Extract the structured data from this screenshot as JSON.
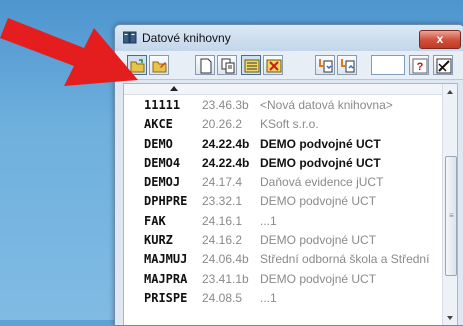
{
  "window": {
    "title": "Datové knihovny",
    "close_label": "x"
  },
  "toolbar": {
    "buttons": [
      {
        "name": "open-folder-button",
        "icon": "open-folder-icon"
      },
      {
        "name": "edit-folder-button",
        "icon": "folder-edit-icon"
      },
      {
        "name": "new-document-button",
        "icon": "document-icon"
      },
      {
        "name": "copy-document-button",
        "icon": "copy-icon"
      },
      {
        "name": "view-list-button",
        "icon": "list-view-icon"
      },
      {
        "name": "delete-button",
        "icon": "delete-icon"
      },
      {
        "name": "import-button",
        "icon": "import-icon"
      },
      {
        "name": "export-button",
        "icon": "export-icon"
      },
      {
        "name": "help-button",
        "icon": "help-icon"
      },
      {
        "name": "settings-button",
        "icon": "pen-icon"
      }
    ],
    "input_value": "",
    "help_label": "?"
  },
  "list": {
    "rows": [
      {
        "code": "11111",
        "version": "23.46.3b",
        "name": "<Nová datová knihovna>",
        "bold": false
      },
      {
        "code": "AKCE",
        "version": "20.26.2",
        "name": "KSoft s.r.o.",
        "bold": false
      },
      {
        "code": "DEMO",
        "version": "24.22.4b",
        "name": "DEMO podvojné UCT",
        "bold": true
      },
      {
        "code": "DEMO4",
        "version": "24.22.4b",
        "name": "DEMO podvojné UCT",
        "bold": true
      },
      {
        "code": "DEMOJ",
        "version": "24.17.4",
        "name": "Daňová evidence jUCT",
        "bold": false
      },
      {
        "code": "DPHPRE",
        "version": "23.32.1",
        "name": "DEMO podvojné UCT",
        "bold": false
      },
      {
        "code": "FAK",
        "version": "24.16.1",
        "name": "...1",
        "bold": false
      },
      {
        "code": "KURZ",
        "version": "24.16.2",
        "name": "DEMO podvojné UCT",
        "bold": false
      },
      {
        "code": "MAJMUJ",
        "version": "24.06.4b",
        "name": "Střední odborná škola a Střední",
        "bold": false
      },
      {
        "code": "MAJPRA",
        "version": "23.41.1b",
        "name": "DEMO podvojné UCT",
        "bold": false
      },
      {
        "code": "PRISPE",
        "version": "24.08.5",
        "name": "...1",
        "bold": false
      }
    ]
  },
  "colors": {
    "desktop": "#5fa3d6",
    "arrow": "#e41e1e",
    "close": "#c13a25"
  }
}
